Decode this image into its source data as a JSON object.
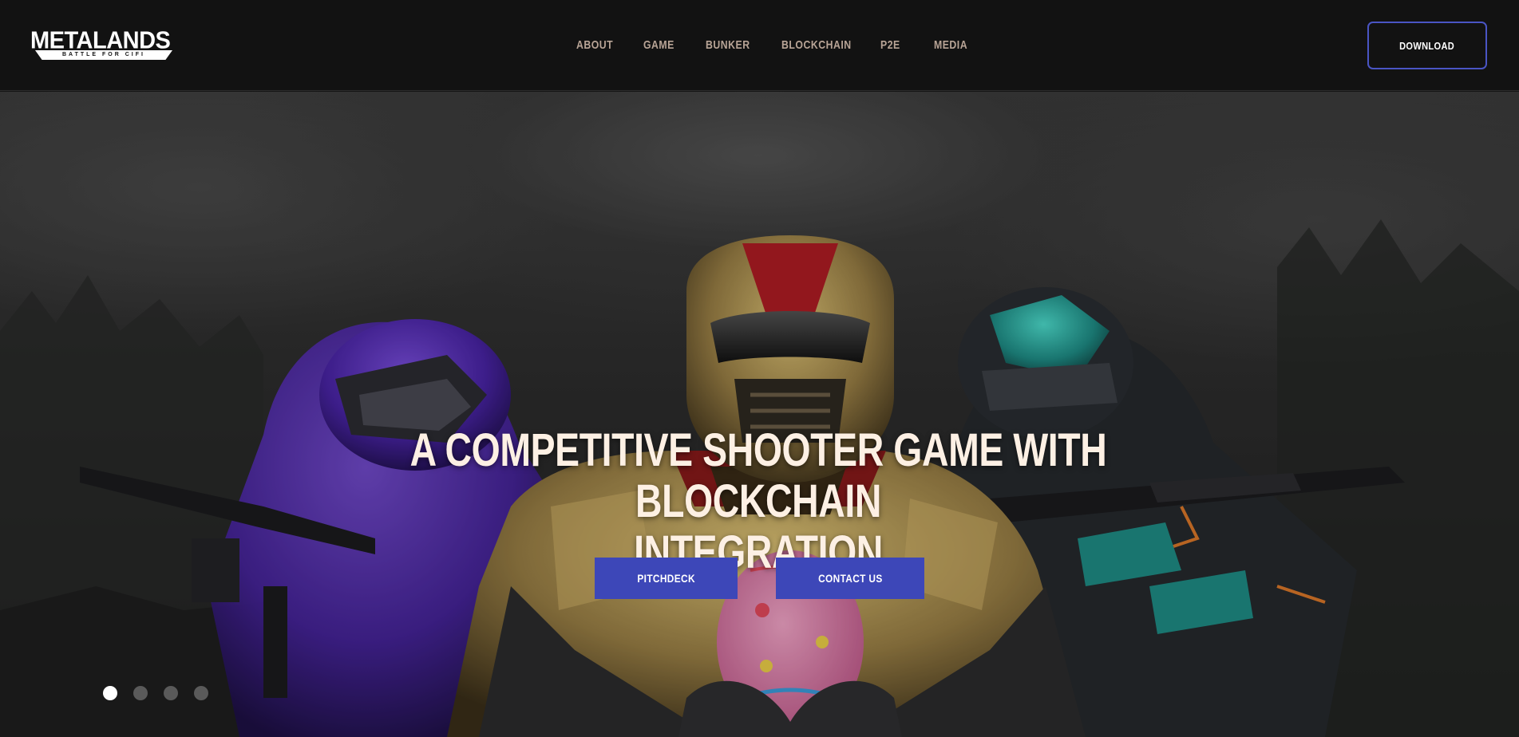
{
  "header": {
    "logo": {
      "name": "METALANDS",
      "tagline": "BATTLE FOR CIFI"
    },
    "nav": [
      {
        "label": "ABOUT"
      },
      {
        "label": "GAME"
      },
      {
        "label": "BUNKER"
      },
      {
        "label": "BLOCKCHAIN"
      },
      {
        "label": "P2E"
      },
      {
        "label": "MEDIA"
      }
    ],
    "download_label": "DOWNLOAD"
  },
  "hero": {
    "title_line1": "A COMPETITIVE SHOOTER GAME WITH BLOCKCHAIN",
    "title_line2": "INTEGRATION",
    "pitchdeck_label": "PITCHDECK",
    "contact_label": "CONTACT US",
    "slider": {
      "count": 4,
      "active_index": 0
    }
  },
  "colors": {
    "header_bg": "#121212",
    "nav_text": "#b8a496",
    "accent_blue": "#3d47b8",
    "download_border": "#4a55c4",
    "title_text": "#fdf0e4"
  }
}
